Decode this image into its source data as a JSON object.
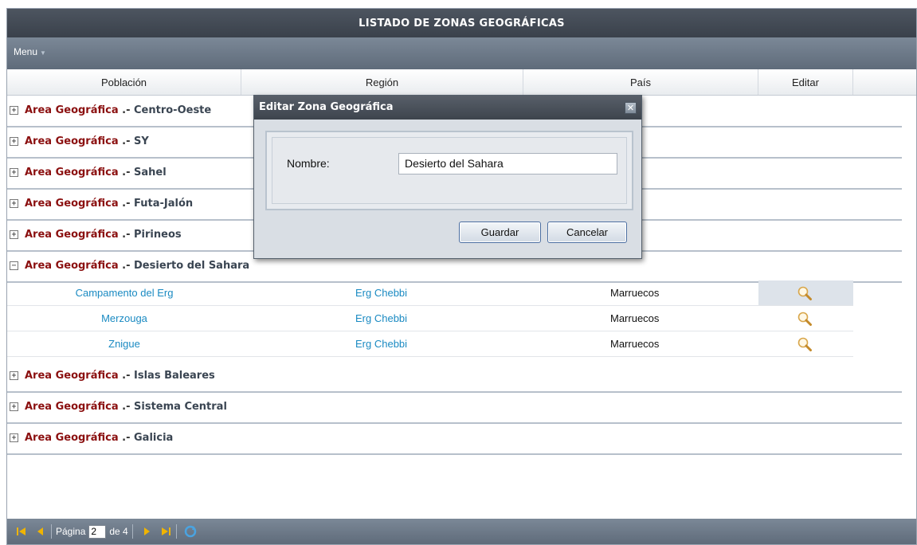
{
  "window": {
    "title": "LISTADO DE ZONAS GEOGRÁFICAS"
  },
  "menu": {
    "label": "Menu"
  },
  "columns": [
    "Población",
    "Región",
    "País",
    "Editar"
  ],
  "group_label": "Area Geográfica",
  "group_separator": ".-",
  "groups": [
    {
      "name": "Centro-Oeste",
      "expanded": false,
      "toggle": "+"
    },
    {
      "name": "SY",
      "expanded": false,
      "toggle": "+"
    },
    {
      "name": "Sahel",
      "expanded": false,
      "toggle": "+"
    },
    {
      "name": "Futa-Jalón",
      "expanded": false,
      "toggle": "+"
    },
    {
      "name": "Pirineos",
      "expanded": false,
      "toggle": "+"
    },
    {
      "name": "Desierto del Sahara",
      "expanded": true,
      "toggle": "−"
    },
    {
      "name": "Islas Baleares",
      "expanded": false,
      "toggle": "+"
    },
    {
      "name": "Sistema Central",
      "expanded": false,
      "toggle": "+"
    },
    {
      "name": "Galicia",
      "expanded": false,
      "toggle": "+"
    }
  ],
  "rows": [
    {
      "poblacion": "Campamento del Erg",
      "region": "Erg Chebbi",
      "pais": "Marruecos",
      "edit_icon": "magnifier-icon",
      "highlighted": true
    },
    {
      "poblacion": "Merzouga",
      "region": "Erg Chebbi",
      "pais": "Marruecos",
      "edit_icon": "magnifier-icon",
      "highlighted": false
    },
    {
      "poblacion": "Znigue",
      "region": "Erg Chebbi",
      "pais": "Marruecos",
      "edit_icon": "magnifier-icon",
      "highlighted": false
    }
  ],
  "pager": {
    "page_label": "Página",
    "page_value": "2",
    "of_label": "de 4"
  },
  "dialog": {
    "title": "Editar Zona Geográfica",
    "field_label": "Nombre:",
    "field_value": "Desierto del Sahara",
    "save_label": "Guardar",
    "cancel_label": "Cancelar",
    "close_glyph": "✕"
  },
  "colors": {
    "header_dark": "#3d444d",
    "toolbar": "#6b7889",
    "group_label": "#8b1010",
    "link": "#1a8ac2",
    "nav_icon": "#f0b400",
    "row_highlight": "#dde3ea"
  }
}
